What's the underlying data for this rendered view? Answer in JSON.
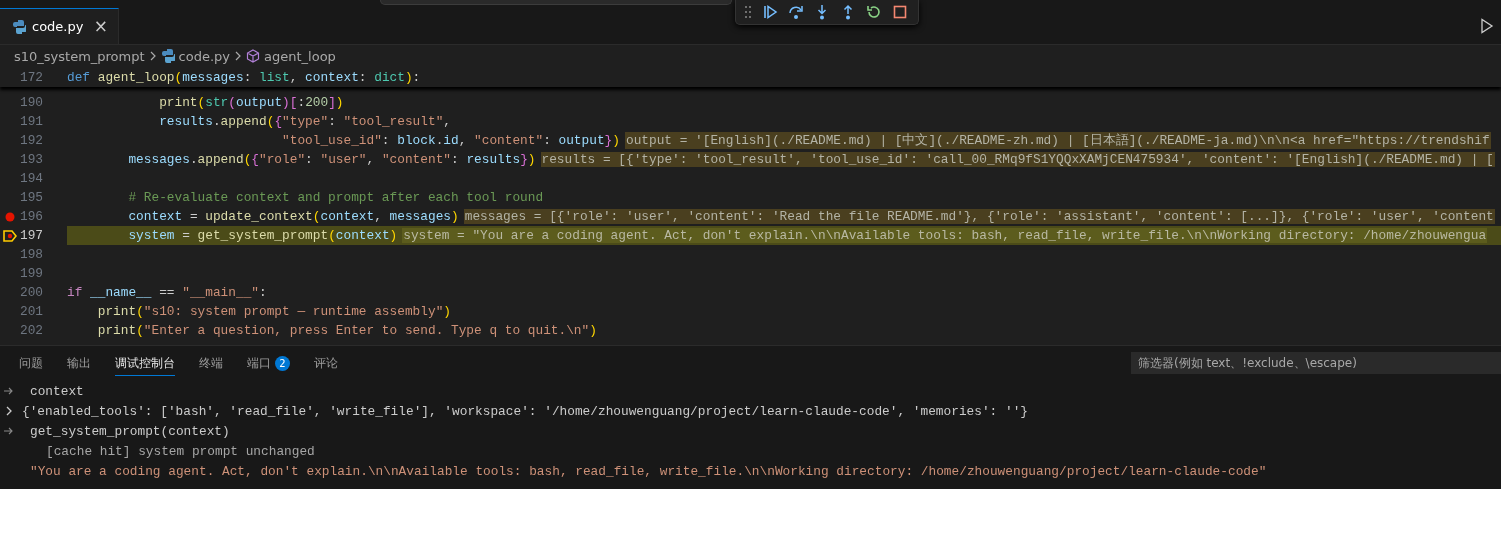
{
  "tabs": [
    {
      "label": "code.py",
      "close": "×",
      "selected": true
    }
  ],
  "breadcrumbs": [
    {
      "label": "s10_system_prompt",
      "kind": "folder"
    },
    {
      "label": "code.py",
      "kind": "file"
    },
    {
      "label": "agent_loop",
      "kind": "symbol"
    }
  ],
  "sticky_line": {
    "number": "172",
    "tokens": [
      {
        "kind": "k",
        "text": "def "
      },
      {
        "kind": "f",
        "text": "agent_loop"
      },
      {
        "kind": "b1",
        "text": "("
      },
      {
        "kind": "v",
        "text": "messages"
      },
      {
        "kind": "p",
        "text": ": "
      },
      {
        "kind": "t",
        "text": "list"
      },
      {
        "kind": "p",
        "text": ", "
      },
      {
        "kind": "v",
        "text": "context"
      },
      {
        "kind": "p",
        "text": ": "
      },
      {
        "kind": "t",
        "text": "dict"
      },
      {
        "kind": "b1",
        "text": ")"
      },
      {
        "kind": "p",
        "text": ":"
      }
    ]
  },
  "code_lines": [
    {
      "number": "190",
      "breakpoint": false,
      "current": false,
      "tokens": [
        {
          "kind": "f",
          "text": "            print"
        },
        {
          "kind": "b1",
          "text": "("
        },
        {
          "kind": "t",
          "text": "str"
        },
        {
          "kind": "b2",
          "text": "("
        },
        {
          "kind": "v",
          "text": "output"
        },
        {
          "kind": "b2",
          "text": ")"
        },
        {
          "kind": "b2",
          "text": "["
        },
        {
          "kind": "p",
          "text": ":"
        },
        {
          "kind": "n",
          "text": "200"
        },
        {
          "kind": "b2",
          "text": "]"
        },
        {
          "kind": "b1",
          "text": ")"
        }
      ]
    },
    {
      "number": "191",
      "breakpoint": false,
      "current": false,
      "tokens": [
        {
          "kind": "v",
          "text": "            results"
        },
        {
          "kind": "p",
          "text": "."
        },
        {
          "kind": "f",
          "text": "append"
        },
        {
          "kind": "b1",
          "text": "("
        },
        {
          "kind": "b2",
          "text": "{"
        },
        {
          "kind": "s",
          "text": "\"type\""
        },
        {
          "kind": "p",
          "text": ": "
        },
        {
          "kind": "s",
          "text": "\"tool_result\""
        },
        {
          "kind": "p",
          "text": ","
        }
      ]
    },
    {
      "number": "192",
      "breakpoint": false,
      "current": false,
      "tokens": [
        {
          "kind": "s",
          "text": "                            \"tool_use_id\""
        },
        {
          "kind": "p",
          "text": ": "
        },
        {
          "kind": "v",
          "text": "block"
        },
        {
          "kind": "p",
          "text": "."
        },
        {
          "kind": "v",
          "text": "id"
        },
        {
          "kind": "p",
          "text": ", "
        },
        {
          "kind": "s",
          "text": "\"content\""
        },
        {
          "kind": "p",
          "text": ": "
        },
        {
          "kind": "v",
          "text": "output"
        },
        {
          "kind": "b2",
          "text": "}"
        },
        {
          "kind": "b1",
          "text": ")"
        }
      ],
      "inline_value": "output = '[English](./README.md) | [中文](./README-zh.md) | [日本語](./README-ja.md)\\n\\n<a href=\"https://trendshif"
    },
    {
      "number": "193",
      "breakpoint": false,
      "current": false,
      "tokens": [
        {
          "kind": "v",
          "text": "        messages"
        },
        {
          "kind": "p",
          "text": "."
        },
        {
          "kind": "f",
          "text": "append"
        },
        {
          "kind": "b1",
          "text": "("
        },
        {
          "kind": "b2",
          "text": "{"
        },
        {
          "kind": "s",
          "text": "\"role\""
        },
        {
          "kind": "p",
          "text": ": "
        },
        {
          "kind": "s",
          "text": "\"user\""
        },
        {
          "kind": "p",
          "text": ", "
        },
        {
          "kind": "s",
          "text": "\"content\""
        },
        {
          "kind": "p",
          "text": ": "
        },
        {
          "kind": "v",
          "text": "results"
        },
        {
          "kind": "b2",
          "text": "}"
        },
        {
          "kind": "b1",
          "text": ")"
        }
      ],
      "inline_value": "results = [{'type': 'tool_result', 'tool_use_id': 'call_00_RMq9fS1YQQxXAMjCEN475934', 'content': '[English](./README.md) | ["
    },
    {
      "number": "194",
      "breakpoint": false,
      "current": false
    },
    {
      "number": "195",
      "breakpoint": false,
      "current": false,
      "tokens": [
        {
          "kind": "m",
          "text": "        # Re-evaluate context and prompt after each tool round"
        }
      ]
    },
    {
      "number": "196",
      "breakpoint": true,
      "current": false,
      "tokens": [
        {
          "kind": "v",
          "text": "        context"
        },
        {
          "kind": "p",
          "text": " = "
        },
        {
          "kind": "f",
          "text": "update_context"
        },
        {
          "kind": "b1",
          "text": "("
        },
        {
          "kind": "v",
          "text": "context"
        },
        {
          "kind": "p",
          "text": ", "
        },
        {
          "kind": "v",
          "text": "messages"
        },
        {
          "kind": "b1",
          "text": ")"
        }
      ],
      "inline_value": "messages = [{'role': 'user', 'content': 'Read the file README.md'}, {'role': 'assistant', 'content': [...]}, {'role': 'user', 'content"
    },
    {
      "number": "197",
      "breakpoint": false,
      "current": true,
      "tokens": [
        {
          "kind": "v",
          "text": "        system"
        },
        {
          "kind": "p",
          "text": " = "
        },
        {
          "kind": "f",
          "text": "get_system_prompt"
        },
        {
          "kind": "b1",
          "text": "("
        },
        {
          "kind": "v",
          "text": "context"
        },
        {
          "kind": "b1",
          "text": ")"
        }
      ],
      "inline_value": "system = \"You are a coding agent. Act, don't explain.\\n\\nAvailable tools: bash, read_file, write_file.\\n\\nWorking directory: /home/zhouwengua"
    },
    {
      "number": "198",
      "breakpoint": false,
      "current": false
    },
    {
      "number": "199",
      "breakpoint": false,
      "current": false
    },
    {
      "number": "200",
      "breakpoint": false,
      "current": false,
      "tokens": [
        {
          "kind": "c",
          "text": "if"
        },
        {
          "kind": "v",
          "text": " __name__"
        },
        {
          "kind": "p",
          "text": " == "
        },
        {
          "kind": "s",
          "text": "\"__main__\""
        },
        {
          "kind": "p",
          "text": ":"
        }
      ]
    },
    {
      "number": "201",
      "breakpoint": false,
      "current": false,
      "tokens": [
        {
          "kind": "f",
          "text": "    print"
        },
        {
          "kind": "b1",
          "text": "("
        },
        {
          "kind": "s",
          "text": "\"s10: system prompt — runtime assembly\""
        },
        {
          "kind": "b1",
          "text": ")"
        }
      ]
    },
    {
      "number": "202",
      "breakpoint": false,
      "current": false,
      "tokens": [
        {
          "kind": "f",
          "text": "    print"
        },
        {
          "kind": "b1",
          "text": "("
        },
        {
          "kind": "s",
          "text": "\"Enter a question, press Enter to send. Type q to quit.\\n\""
        },
        {
          "kind": "b1",
          "text": ")"
        }
      ]
    }
  ],
  "panel_tabs": [
    {
      "label": "问题",
      "selected": false
    },
    {
      "label": "输出",
      "selected": false
    },
    {
      "label": "调试控制台",
      "selected": true
    },
    {
      "label": "终端",
      "selected": false
    },
    {
      "label": "端口",
      "badge": "2",
      "selected": false
    },
    {
      "label": "评论",
      "selected": false
    }
  ],
  "filter": {
    "placeholder": "筛选器(例如 text、!exclude、\\escape)"
  },
  "console": [
    {
      "kind": "input",
      "text": "context"
    },
    {
      "kind": "object",
      "expanded": false,
      "text": "{'enabled_tools': ['bash', 'read_file', 'write_file'], 'workspace': '/home/zhouwenguang/project/learn-claude-code', 'memories': ''}"
    },
    {
      "kind": "input",
      "text": "get_system_prompt(context)"
    },
    {
      "kind": "log",
      "text": "[cache hit] system prompt unchanged"
    },
    {
      "kind": "string",
      "text": "\"You are a coding agent. Act, don't explain.\\n\\nAvailable tools: bash, read_file, write_file.\\n\\nWorking directory: /home/zhouwenguang/project/learn-claude-code\""
    }
  ]
}
